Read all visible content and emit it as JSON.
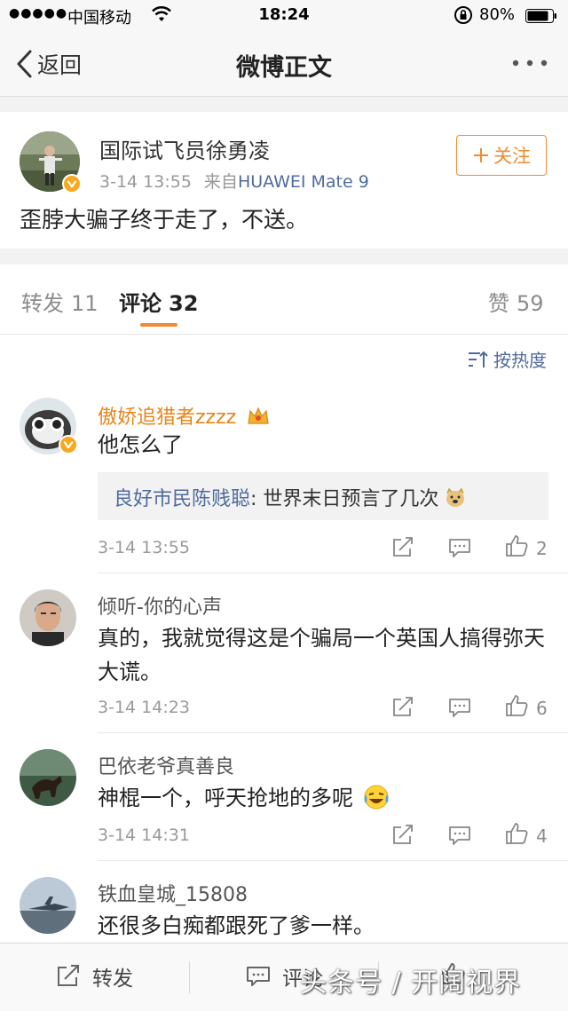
{
  "status_bar": {
    "signal": "●●●●●",
    "carrier": "中国移动",
    "time": "18:24",
    "battery_pct": "80%"
  },
  "nav": {
    "back_label": "返回",
    "title": "微博正文"
  },
  "post": {
    "author": "国际试飞员徐勇凌",
    "time": "3-14 13:55",
    "source_prefix": "来自",
    "source_device": "HUAWEI Mate 9",
    "follow_label": "关注",
    "content": "歪脖大骗子终于走了，不送。"
  },
  "tabs": {
    "repost_label": "转发",
    "repost_count": "11",
    "comment_label": "评论",
    "comment_count": "32",
    "like_label": "赞",
    "like_count": "59"
  },
  "sort_label": "按热度",
  "comments": [
    {
      "user": "傲娇追猎者zzzz",
      "text": "他怎么了",
      "reply_user": "良好市民陈贱聪",
      "reply_text": ": 世界末日预言了几次",
      "time": "3-14 13:55",
      "likes": "2"
    },
    {
      "user": "倾听-你的心声",
      "text": "真的，我就觉得这是个骗局一个英国人搞得弥天大谎。",
      "time": "3-14 14:23",
      "likes": "6"
    },
    {
      "user": "巴依老爷真善良",
      "text": "神棍一个，呼天抢地的多呢",
      "time": "3-14 14:31",
      "likes": "4"
    },
    {
      "user": "铁血皇城_15808",
      "text": "还很多白痴都跟死了爹一样。"
    }
  ],
  "bottom_bar": {
    "repost_label": "转发",
    "comment_label": "评论"
  },
  "watermark": "头条号 / 开阔视界",
  "colors": {
    "accent_orange": "#f28a2e",
    "link_blue": "#506b9e",
    "verified_gold": "#f8a821"
  }
}
